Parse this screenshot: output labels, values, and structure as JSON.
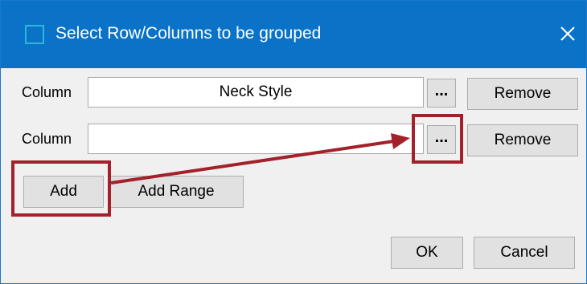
{
  "window": {
    "title": "Select Row/Columns to be grouped"
  },
  "rows": [
    {
      "label": "Column",
      "value": "Neck Style",
      "browse": "...",
      "remove": "Remove"
    },
    {
      "label": "Column",
      "value": "",
      "browse": "...",
      "remove": "Remove"
    }
  ],
  "actions": {
    "add": "Add",
    "add_range": "Add Range"
  },
  "footer": {
    "ok": "OK",
    "cancel": "Cancel"
  },
  "icons": {
    "close": "close-icon",
    "window": "window-icon"
  },
  "colors": {
    "titlebar": "#0b73c7",
    "highlight": "#a3212a",
    "dialog": "#f0f0f0"
  }
}
